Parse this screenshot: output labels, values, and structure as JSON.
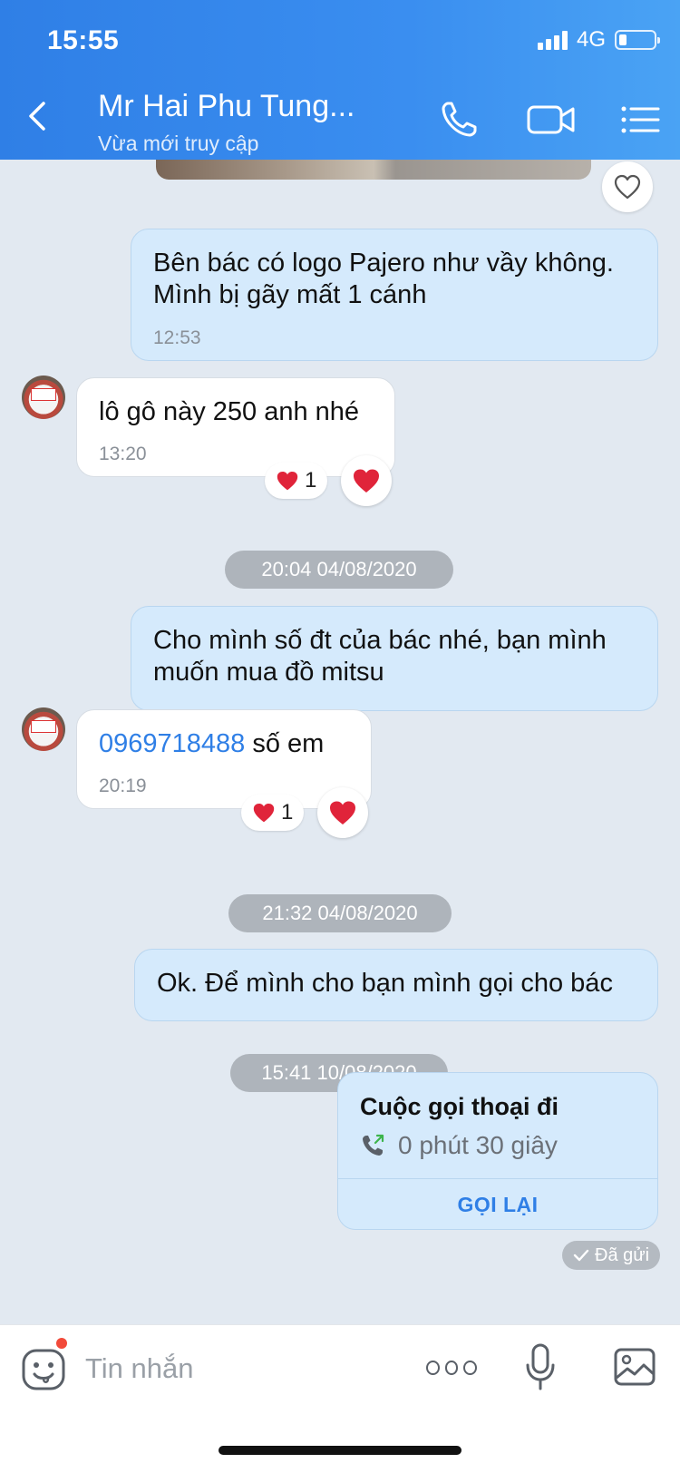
{
  "status_bar": {
    "time": "15:55",
    "network": "4G"
  },
  "header": {
    "title": "Mr Hai Phu Tung...",
    "subtitle": "Vừa mới truy cập"
  },
  "messages": [
    {
      "direction": "out",
      "lines": [
        "Bên bác có logo Pajero như vầy không.",
        "Mình bị gãy mất 1 cánh"
      ],
      "time": "12:53"
    },
    {
      "direction": "in",
      "text": "lô gô này 250 anh nhé",
      "time": "13:20",
      "reaction_count": "1"
    },
    {
      "date_chip": "20:04 04/08/2020"
    },
    {
      "direction": "out",
      "lines": [
        "Cho mình số đt của bác nhé, bạn mình",
        "muốn mua đồ mitsu"
      ]
    },
    {
      "direction": "in",
      "phone": "0969718488",
      "text": " số em",
      "time": "20:19",
      "reaction_count": "1"
    },
    {
      "date_chip": "21:32 04/08/2020"
    },
    {
      "direction": "out",
      "text": "Ok. Để mình cho bạn mình gọi cho bác"
    },
    {
      "date_chip": "15:41 10/08/2020"
    }
  ],
  "call_card": {
    "title": "Cuộc gọi thoại đi",
    "duration": "0 phút 30 giây",
    "action": "GỌI LẠI"
  },
  "sent_status": "Đã gửi",
  "input": {
    "placeholder": "Tin nhắn"
  },
  "icons": {
    "back": "chevron-left-icon",
    "call": "phone-icon",
    "video": "video-camera-icon",
    "menu": "list-menu-icon",
    "like": "heart-outline-icon",
    "reaction": "red-heart-icon",
    "sticker": "emoji-face-icon",
    "more": "more-dots-icon",
    "mic": "microphone-icon",
    "image": "image-icon"
  },
  "colors": {
    "header_blue": "#3a8ef0",
    "bubble_out": "#d5eafc",
    "bubble_in": "#ffffff",
    "link": "#2f7fe6",
    "heart": "#e0243a"
  }
}
